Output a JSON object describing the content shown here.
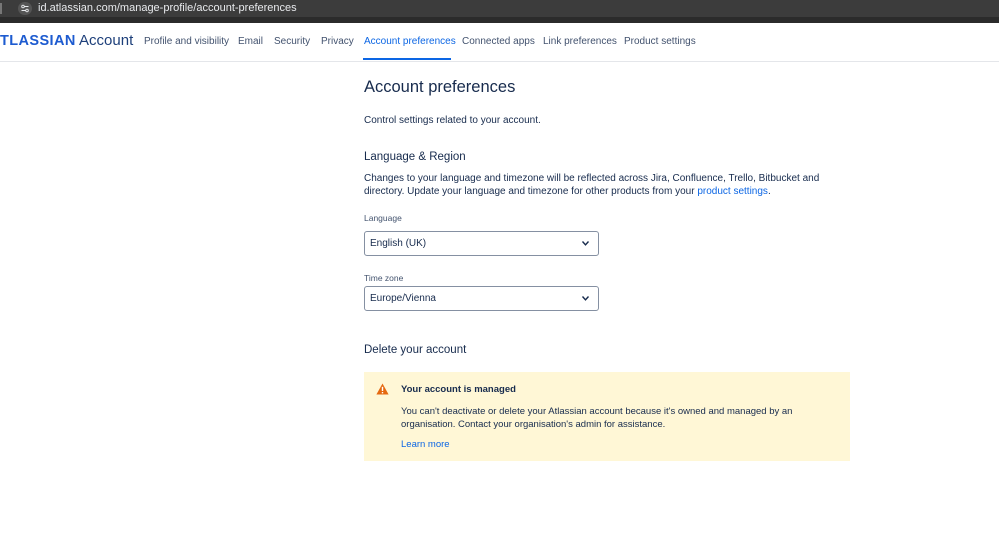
{
  "browser": {
    "url": "id.atlassian.com/manage-profile/account-preferences"
  },
  "header": {
    "logo_brand": "TLASSIAN",
    "logo_suffix": " Account",
    "nav": [
      {
        "label": "Profile and visibility"
      },
      {
        "label": "Email"
      },
      {
        "label": "Security"
      },
      {
        "label": "Privacy"
      },
      {
        "label": "Account preferences",
        "active": true
      },
      {
        "label": "Connected apps"
      },
      {
        "label": "Link preferences"
      },
      {
        "label": "Product settings"
      }
    ]
  },
  "page": {
    "title": "Account preferences",
    "intro": "Control settings related to your account."
  },
  "language_region": {
    "heading": "Language & Region",
    "description": "Changes to your language and timezone will be reflected across Jira, Confluence, Trello, Bitbucket and directory. Update your language and timezone for other products from your ",
    "link_text": "product settings",
    "link_suffix": ".",
    "language_label": "Language",
    "language_value": "English (UK)",
    "timezone_label": "Time zone",
    "timezone_value": "Europe/Vienna"
  },
  "delete_account": {
    "heading": "Delete your account",
    "notice_title": "Your account is managed",
    "notice_body": "You can't deactivate or delete your Atlassian account because it's owned and managed by an organisation. Contact your organisation's admin for assistance.",
    "notice_link": "Learn more"
  },
  "colors": {
    "accent": "#0c66e4",
    "notice_bg": "#fff7d6",
    "warning": "#e56910"
  }
}
